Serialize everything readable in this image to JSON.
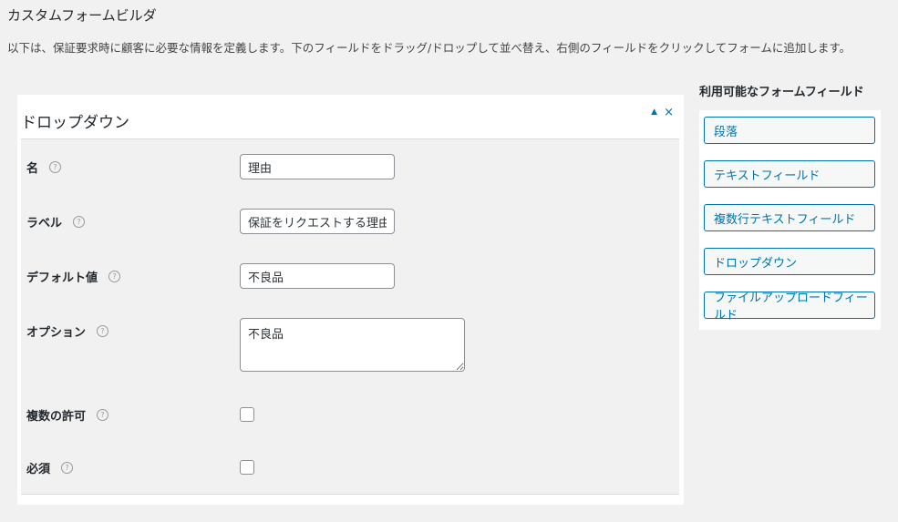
{
  "page": {
    "title": "カスタムフォームビルダ",
    "description": "以下は、保証要求時に顧客に必要な情報を定義します。下のフィールドをドラッグ/ドロップして並べ替え、右側のフィールドをクリックしてフォームに追加します。"
  },
  "field": {
    "title": "ドロップダウン",
    "controls": {
      "collapse_icon": "▲",
      "close_icon": "×"
    },
    "rows": {
      "name": {
        "label": "名",
        "value": "理由"
      },
      "label": {
        "label": "ラベル",
        "value": "保証をリクエストする理由"
      },
      "default": {
        "label": "デフォルト値",
        "value": "不良品"
      },
      "options": {
        "label": "オプション",
        "value": "不良品"
      },
      "multiple": {
        "label": "複数の許可",
        "checked": false
      },
      "required": {
        "label": "必須",
        "checked": false
      }
    },
    "help_icon": "?"
  },
  "sidebar": {
    "title": "利用可能なフォームフィールド",
    "items": [
      {
        "label": "段落"
      },
      {
        "label": "テキストフィールド"
      },
      {
        "label": "複数行テキストフィールド"
      },
      {
        "label": "ドロップダウン"
      },
      {
        "label": "ファイルアップロードフィールド"
      }
    ]
  },
  "colors": {
    "accent": "#0073aa",
    "background": "#f1f1f1"
  }
}
